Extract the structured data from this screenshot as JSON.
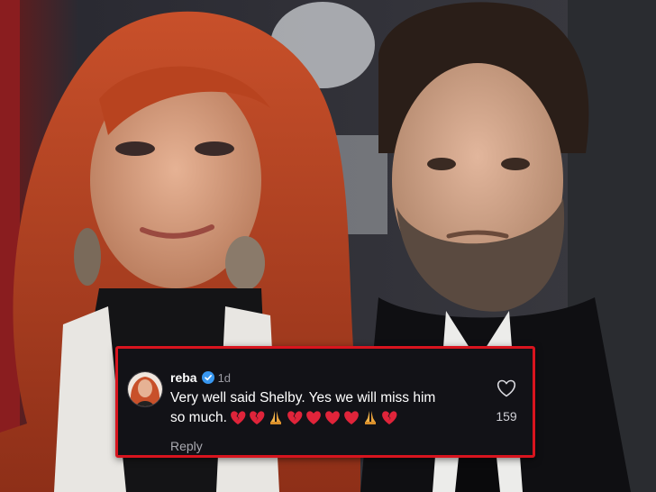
{
  "comment": {
    "username": "reba",
    "verified_icon": "verified-badge-icon",
    "time_ago": "1d",
    "text_line": "Very well said Shelby. Yes we will miss him",
    "text_prefix": "so much.",
    "emojis": [
      "broken-heart",
      "broken-heart",
      "folded-hands",
      "broken-heart",
      "red-heart",
      "red-heart",
      "red-heart",
      "folded-hands",
      "broken-heart"
    ],
    "reply_label": "Reply",
    "like_icon": "heart-outline-icon",
    "like_count": "159"
  },
  "colors": {
    "card_border": "#d8141e",
    "card_bg": "#121217",
    "verified": "#3897f0",
    "emoji_heart": "#e0243a"
  }
}
